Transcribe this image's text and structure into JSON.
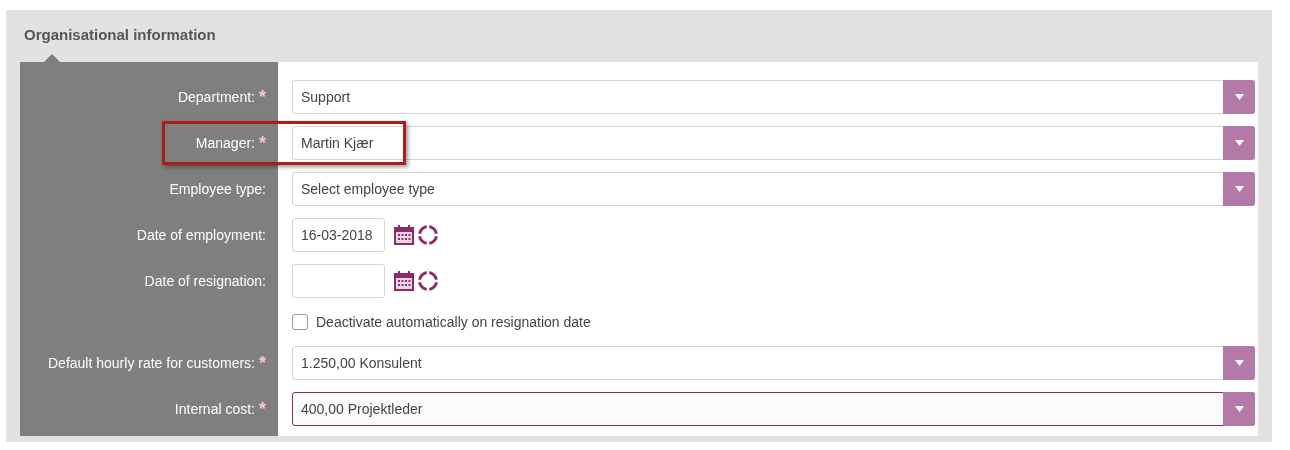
{
  "section": {
    "title": "Organisational information"
  },
  "fields": [
    {
      "kind": "select",
      "label": "Department:",
      "required_mark": "*",
      "value": "Support"
    },
    {
      "kind": "select",
      "label": "Manager:",
      "required_mark": "*",
      "value": "Martin Kjær",
      "highlighted": true
    },
    {
      "kind": "select",
      "label": "Employee type:",
      "placeholder": "Select employee type"
    },
    {
      "kind": "date",
      "label": "Date of employment:",
      "value": "16-03-2018"
    },
    {
      "kind": "date",
      "label": "Date of resignation:"
    },
    {
      "kind": "checkbox",
      "text": "Deactivate automatically on resignation date",
      "checked": false
    },
    {
      "kind": "select",
      "label": "Default hourly rate for customers:",
      "required_mark": "*",
      "value": "1.250,00 Konsulent"
    },
    {
      "kind": "select",
      "label": "Internal cost:",
      "required_mark": "*",
      "value": "400,00 Projektleder",
      "focused": true
    }
  ]
}
